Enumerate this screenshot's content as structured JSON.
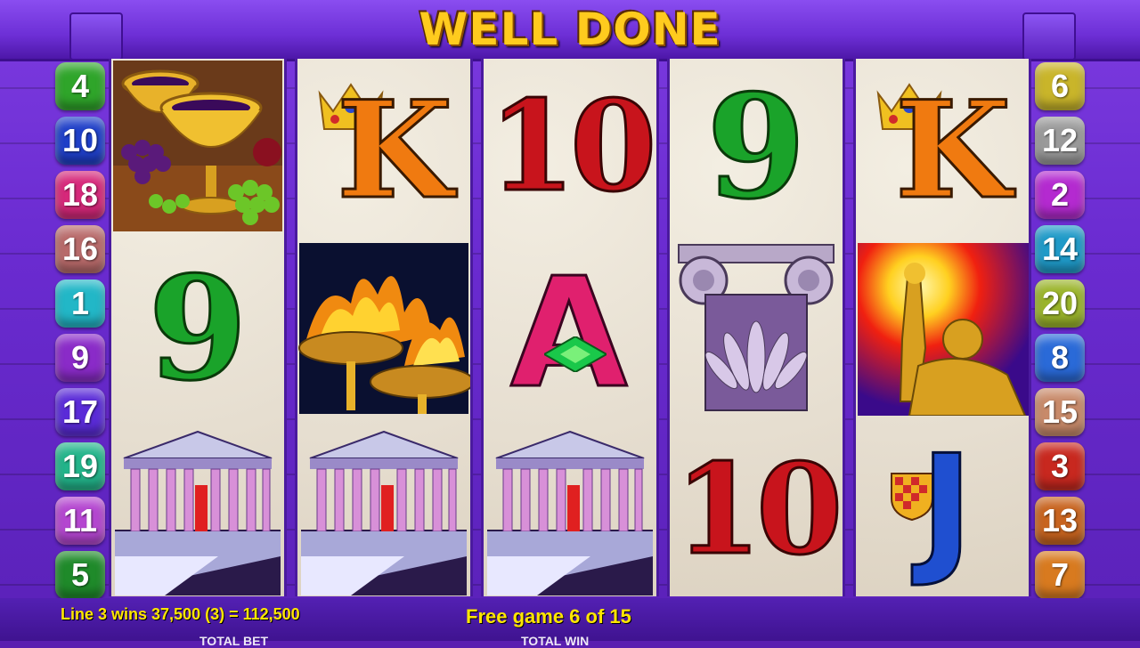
{
  "title": "WELL DONE",
  "status": {
    "win_message": "Line 3 wins 37,500 (3) = 112,500",
    "free_games": "Free game 6 of 15",
    "total_bet_label": "TOTAL BET",
    "total_win_label": "TOTAL WIN"
  },
  "left_lines": [
    {
      "num": "4",
      "color": "#2fa52a"
    },
    {
      "num": "10",
      "color": "#1f3fc8"
    },
    {
      "num": "18",
      "color": "#d6287a"
    },
    {
      "num": "16",
      "color": "#b86a6a"
    },
    {
      "num": "1",
      "color": "#22b7c7"
    },
    {
      "num": "9",
      "color": "#8a2bc8"
    },
    {
      "num": "17",
      "color": "#5a2bd8"
    },
    {
      "num": "19",
      "color": "#22b48a"
    },
    {
      "num": "11",
      "color": "#b446d0"
    },
    {
      "num": "5",
      "color": "#1f8a2a"
    }
  ],
  "right_lines": [
    {
      "num": "6",
      "color": "#c9b52a"
    },
    {
      "num": "12",
      "color": "#9a9a9a"
    },
    {
      "num": "2",
      "color": "#b42ad0"
    },
    {
      "num": "14",
      "color": "#1f9ac8"
    },
    {
      "num": "20",
      "color": "#9ab42a"
    },
    {
      "num": "8",
      "color": "#2a6ad8"
    },
    {
      "num": "15",
      "color": "#c88a6a"
    },
    {
      "num": "3",
      "color": "#c8281f"
    },
    {
      "num": "13",
      "color": "#c8641f"
    },
    {
      "num": "7",
      "color": "#d87a1f"
    }
  ],
  "reels": [
    [
      "goblet-symbol",
      "nine-symbol",
      "temple-symbol"
    ],
    [
      "king-symbol",
      "torch-symbol",
      "temple-symbol"
    ],
    [
      "ten-symbol",
      "ace-symbol",
      "temple-symbol"
    ],
    [
      "nine-symbol",
      "column-symbol",
      "ten-symbol"
    ],
    [
      "king-symbol",
      "hero-symbol",
      "jack-symbol"
    ]
  ],
  "symbol_text": {
    "nine": "9",
    "ten": "10",
    "king": "K",
    "ace": "A",
    "jack": "J"
  },
  "colors": {
    "nine": "#1aa32a",
    "ten": "#c8141c",
    "king": "#f07a10",
    "ace": "#e0206e",
    "jack": "#1f4fd0",
    "title": "#ffcb1e",
    "status_text": "#ffe600"
  }
}
